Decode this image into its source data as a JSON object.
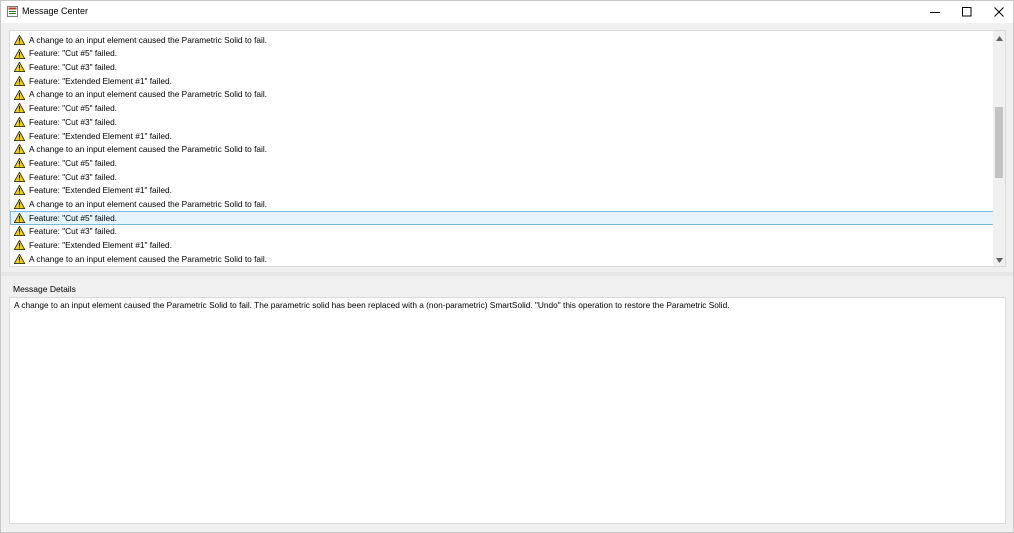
{
  "window": {
    "title": "Message Center",
    "icon": "message-center-app-icon",
    "controls": {
      "minimize_icon": "minimize-icon",
      "maximize_icon": "maximize-icon",
      "close_icon": "close-icon"
    }
  },
  "messages": [
    {
      "icon": "warning-icon",
      "text": "A change to an input element caused the Parametric Solid to fail.",
      "selected": false
    },
    {
      "icon": "warning-icon",
      "text": "Feature: \"Cut #5\" failed.",
      "selected": false
    },
    {
      "icon": "warning-icon",
      "text": "Feature: \"Cut #3\" failed.",
      "selected": false
    },
    {
      "icon": "warning-icon",
      "text": "Feature: \"Extended Element #1\" failed.",
      "selected": false
    },
    {
      "icon": "warning-icon",
      "text": "A change to an input element caused the Parametric Solid to fail.",
      "selected": false
    },
    {
      "icon": "warning-icon",
      "text": "Feature: \"Cut #5\" failed.",
      "selected": false
    },
    {
      "icon": "warning-icon",
      "text": "Feature: \"Cut #3\" failed.",
      "selected": false
    },
    {
      "icon": "warning-icon",
      "text": "Feature: \"Extended Element #1\" failed.",
      "selected": false
    },
    {
      "icon": "warning-icon",
      "text": "A change to an input element caused the Parametric Solid to fail.",
      "selected": false
    },
    {
      "icon": "warning-icon",
      "text": "Feature: \"Cut #5\" failed.",
      "selected": false
    },
    {
      "icon": "warning-icon",
      "text": "Feature: \"Cut #3\" failed.",
      "selected": false
    },
    {
      "icon": "warning-icon",
      "text": "Feature: \"Extended Element #1\" failed.",
      "selected": false
    },
    {
      "icon": "warning-icon",
      "text": "A change to an input element caused the Parametric Solid to fail.",
      "selected": false
    },
    {
      "icon": "warning-icon",
      "text": "Feature: \"Cut #5\" failed.",
      "selected": true
    },
    {
      "icon": "warning-icon",
      "text": "Feature: \"Cut #3\" failed.",
      "selected": false
    },
    {
      "icon": "warning-icon",
      "text": "Feature: \"Extended Element #1\" failed.",
      "selected": false
    },
    {
      "icon": "warning-icon",
      "text": "A change to an input element caused the Parametric Solid to fail.",
      "selected": false
    }
  ],
  "details": {
    "label": "Message Details",
    "text": "A change to an input element caused the Parametric Solid to fail.  The parametric solid has been replaced with a (non-parametric) SmartSolid. \"Undo\" this operation to restore the Parametric Solid."
  },
  "colors": {
    "selection_bg": "#e5f3fb",
    "selection_border": "#7ab8de",
    "warning_yellow": "#f5d000"
  }
}
